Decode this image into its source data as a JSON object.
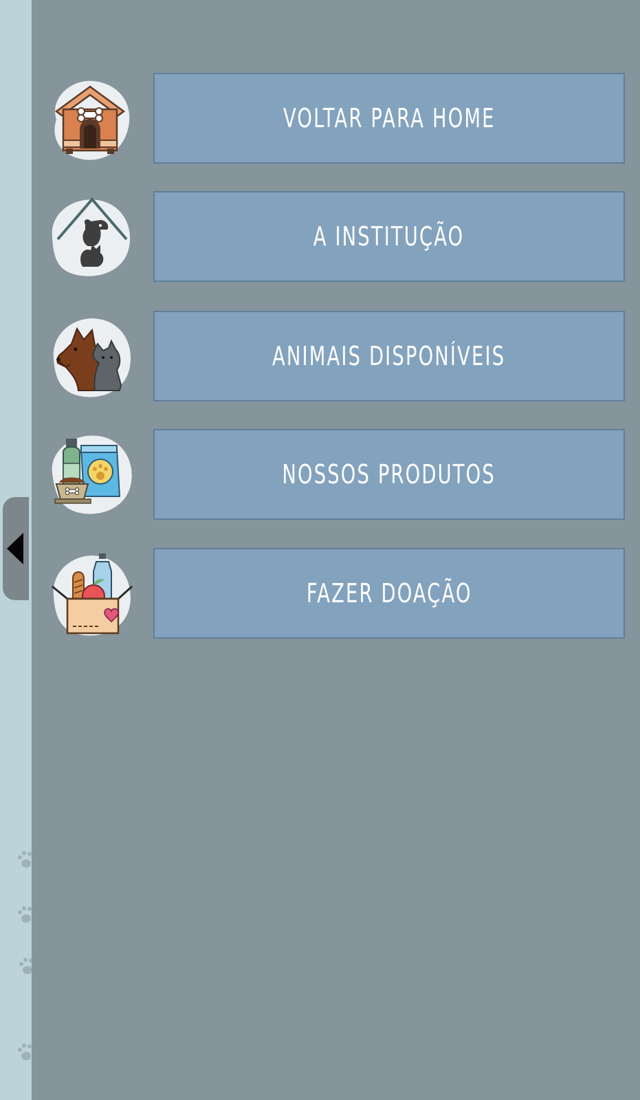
{
  "drawer": {
    "background": "#86949b",
    "button_color": "#83a2bd",
    "items": [
      {
        "label": "VOLTAR PARA HOME",
        "icon": "doghouse-icon"
      },
      {
        "label": "A INSTITUÇÃO",
        "icon": "shelter-pets-icon"
      },
      {
        "label": "ANIMAIS DISPONÍVEIS",
        "icon": "dog-cat-icon"
      },
      {
        "label": "NOSSOS PRODUTOS",
        "icon": "pet-products-icon"
      },
      {
        "label": "FAZER DOAÇÃO",
        "icon": "donation-box-icon"
      }
    ]
  },
  "handle": {
    "icon": "triangle-left-icon"
  }
}
